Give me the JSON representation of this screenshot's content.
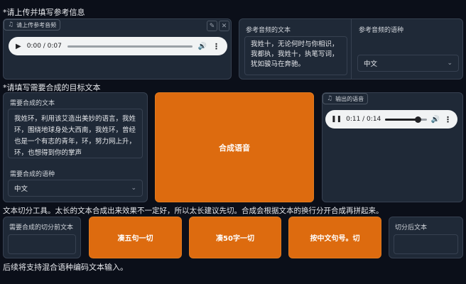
{
  "ref_section": {
    "title": "*请上传并填写参考信息",
    "audio_label": "请上传参考音频",
    "audio_time": "0:00 / 0:07",
    "audio_progress": 0,
    "ref_text_label": "参考音频的文本",
    "ref_text_value": "我姓十，无论何时与你相识，我都执，我姓十，执笔写词，犹如骏马在奔驰。",
    "ref_lang_label": "参考音频的语种",
    "ref_lang_value": "中文"
  },
  "target_section": {
    "title": "*请填写需要合成的目标文本",
    "text_label": "需要合成的文本",
    "text_value": "我姓环，利用该艾造出美妙的语言，我姓环，围绕地球身处大西南，我姓环，曾经也是一个有志的青年，环，努力网上升，环，也想得到你的掌声",
    "lang_label": "需要合成的语种",
    "lang_value": "中文",
    "synth_button": "合成语音",
    "output_label": "输出的语音",
    "output_time": "0:11 / 0:14",
    "output_progress": 0.79
  },
  "split_section": {
    "title": "文本切分工具。太长的文本合成出来效果不一定好，所以太长建议先切。合成会根据文本的换行分开合成再拼起来。",
    "input_label": "需要合成的切分前文本",
    "btn_five": "凑五句一切",
    "btn_fifty": "凑50字一切",
    "btn_period": "按中文句号。切",
    "output_label": "切分后文本"
  },
  "footer_text": "后续将支持混合语种编码文本输入。",
  "icons": {
    "music": "music-note-icon",
    "edit": "pencil-icon",
    "close": "close-icon",
    "play": "play-icon",
    "pause": "pause-icon",
    "volume": "volume-icon",
    "more": "more-vert-icon",
    "chevron": "chevron-down-icon"
  },
  "colors": {
    "background": "#0b0f19",
    "panel": "#1f2937",
    "accent_orange": "#dd6b0f"
  }
}
